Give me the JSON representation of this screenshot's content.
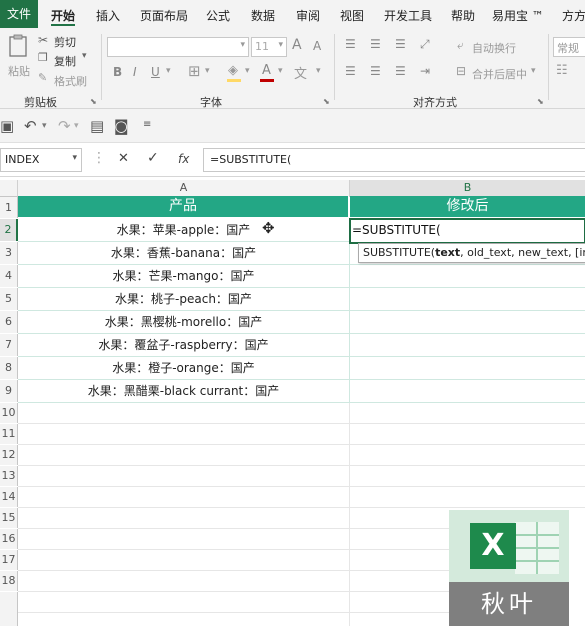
{
  "menu": {
    "file": "文件",
    "items": [
      "开始",
      "插入",
      "页面布局",
      "公式",
      "数据",
      "审阅",
      "视图",
      "开发工具",
      "帮助",
      "易用宝 ™",
      "方方"
    ]
  },
  "ribbon": {
    "paste": "粘贴",
    "cut": "剪切",
    "copy": "复制",
    "format_painter": "格式刷",
    "clipboard_group": "剪贴板",
    "font_size": "11",
    "grow_font": "A",
    "shrink_font": "A",
    "bold": "B",
    "italic": "I",
    "underline": "U",
    "font_color": "A",
    "font_group": "字体",
    "wrap_text": "自动换行",
    "merge_center": "合并后居中",
    "align_group": "对齐方式",
    "number_format": "常规"
  },
  "formula_bar": {
    "name_box": "INDEX",
    "cancel": "✕",
    "enter": "✓",
    "fx": "fx",
    "content": "=SUBSTITUTE("
  },
  "sheet": {
    "columns": [
      "A",
      "B"
    ],
    "rows": [
      "1",
      "2",
      "3",
      "4",
      "5",
      "6",
      "7",
      "8",
      "9",
      "10",
      "11",
      "12",
      "13",
      "14",
      "15",
      "16",
      "17",
      "18"
    ],
    "header_a": "产品",
    "header_b": "修改后",
    "products": [
      "水果：苹果-apple：国产",
      "水果：香蕉-banana：国产",
      "水果：芒果-mango：国产",
      "水果：桃子-peach：国产",
      "水果：黑樱桃-morello：国产",
      "水果：覆盆子-raspberry：国产",
      "水果：橙子-orange：国产",
      "水果：黑醋栗-black currant：国产"
    ],
    "active_cell_text": "=SUBSTITUTE(",
    "tooltip": {
      "func": "SUBSTITUTE(",
      "arg1": "text",
      "rest": ", old_text, new_text, [instance"
    }
  },
  "watermark": {
    "logo_letter": "X",
    "caption": "秋叶"
  },
  "colors": {
    "accent": "#217346",
    "header_fill": "#23a785",
    "logo_green": "#1e8a4c"
  }
}
